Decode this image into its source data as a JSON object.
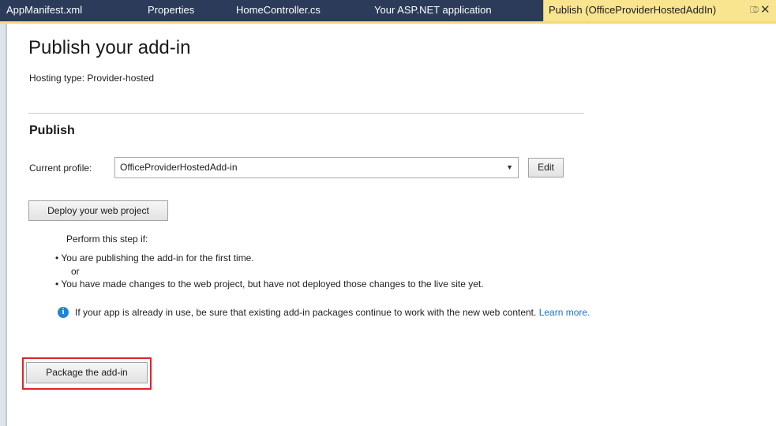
{
  "tabs": [
    {
      "label": "AppManifest.xml"
    },
    {
      "label": "Properties"
    },
    {
      "label": "HomeController.cs"
    },
    {
      "label": "Your ASP.NET application"
    },
    {
      "label": "Publish (OfficeProviderHostedAddIn)"
    }
  ],
  "icons": {
    "pin": "pin-icon",
    "close": "close-icon",
    "info": "info-icon"
  },
  "page": {
    "title": "Publish your add-in",
    "hosting": "Hosting type: Provider-hosted"
  },
  "publish": {
    "section_title": "Publish",
    "profile_label": "Current profile:",
    "profile_value": "OfficeProviderHostedAdd-in",
    "edit_label": "Edit",
    "deploy_label": "Deploy your web project",
    "perform_text": "Perform this step if:",
    "bullet1": "You are publishing the add-in for the first time.",
    "or_text": "or",
    "bullet2": "You have made changes to the web project, but have not deployed those changes to the live site yet.",
    "note_text": "If your app is already in use, be sure that existing add-in packages continue to work with the new web content.",
    "learn_more": "Learn more.",
    "package_label": "Package the add-in"
  },
  "colors": {
    "tabbar": "#2b3b59",
    "active_tab": "#f9e58f",
    "highlight": "#e0242c",
    "link": "#1a73c8"
  }
}
